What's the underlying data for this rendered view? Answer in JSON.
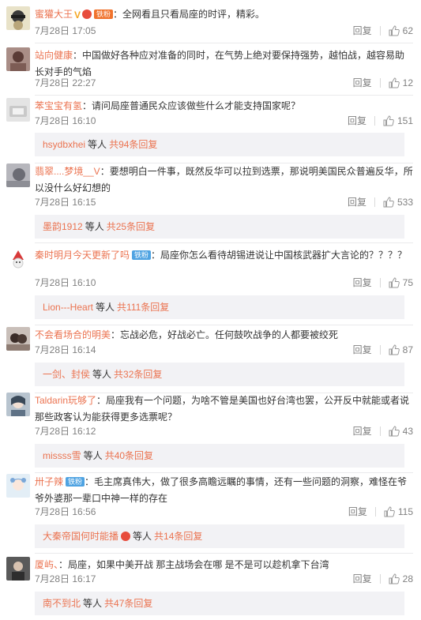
{
  "colors": {
    "username": "#eb7350",
    "meta": "#808080",
    "reply_box": "#f2f2f5",
    "fan_badge": "#4fa3e2",
    "vip_badge": "#f0732d"
  },
  "icons": {
    "like": "thumbs-up-icon",
    "verified": "yellow-v-icon",
    "medal": "medal-icon"
  },
  "comments": [
    {
      "user": "蜜獾大王",
      "text": "：全网看且只看局座的时评，精彩。",
      "date": "7月28日 17:05",
      "reply": "回复",
      "likes": "62",
      "badge": "铁粉"
    },
    {
      "user": "站向健康",
      "text": "：中国做好各种应对准备的同时，在气势上绝对要保持强势，越怕战，越容易助长对手的气焰",
      "date": "7月28日 22:27",
      "reply": "回复",
      "likes": "12"
    },
    {
      "user": "苯宝宝有氢",
      "text": "：请问局座普通民众应该做些什么才能支持国家呢？",
      "date": "7月28日 16:10",
      "reply": "回复",
      "likes": "151",
      "replies": {
        "user": "hsydbxhei",
        "deng": "等人",
        "total": "共94条回复"
      }
    },
    {
      "user": "翡翠....梦境__V",
      "text": "：要想明白一件事，既然反华可以拉到选票，那说明美国民众普遍反华，所以没什么好幻想的",
      "date": "7月28日 16:15",
      "reply": "回复",
      "likes": "533",
      "replies": {
        "user": "墨韵1912",
        "deng": "等人",
        "total": "共25条回复"
      }
    },
    {
      "user": "秦时明月今天更新了吗",
      "text": "：局座你怎么看待胡锡进说让中国核武器扩大言论的？？？？",
      "date": "7月28日 16:10",
      "reply": "回复",
      "likes": "75",
      "badge": "铁粉",
      "replies": {
        "user": "Lion---Heart",
        "deng": "等人",
        "total": "共111条回复"
      }
    },
    {
      "user": "不会看场合的明美",
      "text": "：忘战必危，好战必亡。任何鼓吹战争的人都要被绞死",
      "date": "7月28日 16:14",
      "reply": "回复",
      "likes": "87",
      "replies": {
        "user": "一剑、封侯",
        "deng": "等人",
        "total": "共32条回复"
      }
    },
    {
      "user": "Taldarin玩够了",
      "text": "：局座我有一个问题，为啥不管是美国也好台湾也罢，公开反中就能或者说那些政客认为能获得更多选票呢？",
      "date": "7月28日 16:12",
      "reply": "回复",
      "likes": "43",
      "replies": {
        "user": "missss雪",
        "deng": "等人",
        "total": "共40条回复"
      }
    },
    {
      "user": "卅子辣",
      "text": "：毛主席真伟大，做了很多高瞻远瞩的事情，还有一些问题的洞察，难怪在爷爷外婆那一辈口中神一样的存在",
      "date": "7月28日 16:56",
      "reply": "回复",
      "likes": "115",
      "badge": "铁粉",
      "replies": {
        "user": "大秦帝国何时能播",
        "deng": "等人",
        "total": "共14条回复"
      }
    },
    {
      "user": "厦屿、",
      "text": "：局座，如果中美开战 那主战场会在哪 是不是可以趁机拿下台湾",
      "date": "7月28日 16:17",
      "reply": "回复",
      "likes": "28",
      "replies": {
        "user": "南不到北",
        "deng": "等人",
        "total": "共47条回复"
      }
    }
  ]
}
